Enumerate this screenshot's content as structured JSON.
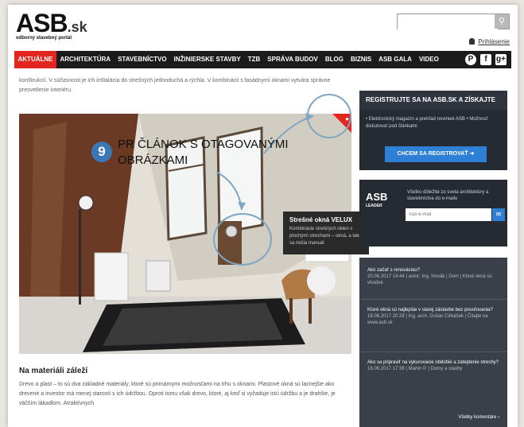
{
  "header": {
    "logo": "ASB",
    "logo_tld": ".sk",
    "tagline": "odborný stavebný portál",
    "search_placeholder": "",
    "login_label": "Prihlásenie"
  },
  "nav": {
    "items": [
      "AKTUÁLNE",
      "ARCHITEKTÚRA",
      "STAVEBNÍCTVO",
      "INŽINIERSKE STAVBY",
      "TZB",
      "SPRÁVA BUDOV",
      "BLOG",
      "BIZNIS",
      "ASB GALA",
      "VIDEO"
    ],
    "social": [
      "P",
      "f",
      "g+"
    ]
  },
  "article": {
    "intro": "konštrukcií. V súčasnosti je ich inštalácia do strešných jednoduchá a rýchla. V kombinácii s fasádnymi oknami vytvára správne presvetlenie interiéru.",
    "section_heading": "Na materiáli záleží",
    "body": "Drevo a plast – to sú dva základné materiály, ktoré sú primárnymi možnosťami na trhu s oknami. Plastové okná sú lacnejšie ako drevené a investor má menej starostí s ich údržbou. Oproti tomu však drevo, ktoré, aj keď si vyžaduje istú údržbu a je drahšie, je väčším lákadlom. Atraktívnych",
    "tooltip_title": "Strešné okná VELUX",
    "tooltip_desc": "Kombinácie strešných okien s plochými strechami – okná, a také sa riešia manuál"
  },
  "annotation": {
    "number": "9",
    "text": "PR ČLÁNOK S OTAGOVANÝMI OBRÁZKAMI"
  },
  "sidebar": {
    "register": {
      "heading": "REGISTRUJTE SA NA ASB.SK A ZÍSKAJTE",
      "text": "• Elektronický magazín a prehľad noviniek ASB • Možnosť diskutovať pod článkami",
      "button": "CHCEM SA REGISTROVAŤ"
    },
    "newsletter": {
      "logo": "ASB",
      "sub": "LEADER",
      "text": "Všetko dôležité zo sveta architektúry a stavebníctva do e-mailu",
      "placeholder": "Váš e-mail"
    },
    "comments": [
      {
        "q": "Ako začať s renováciou?",
        "m": "20.06.2017 14:44 | autor: Ing. Novák | Dom | Ktoré okná sú vhodné"
      },
      {
        "q": "Ktoré okná sú najlepšie v starej zástavbe bez povoľovania?",
        "m": "18.06.2017 20:28 | Ing. arch. Dušan Cirbáček | Čítajte na www.asb.sk"
      },
      {
        "q": "Ako sa pripraviť na vykurovacie obdobie a zateplenie strechy?",
        "m": "16.06.2017 17:38 | Martin P. | Domy a stavby"
      }
    ],
    "all_comments": "Všetky komentáre ›"
  },
  "colors": {
    "accent": "#e3251f",
    "nav_bg": "#1b1b1b",
    "sidebar_bg": "#262a33",
    "button_blue": "#2e7fd6",
    "annotation_blue": "#3c77b5"
  }
}
